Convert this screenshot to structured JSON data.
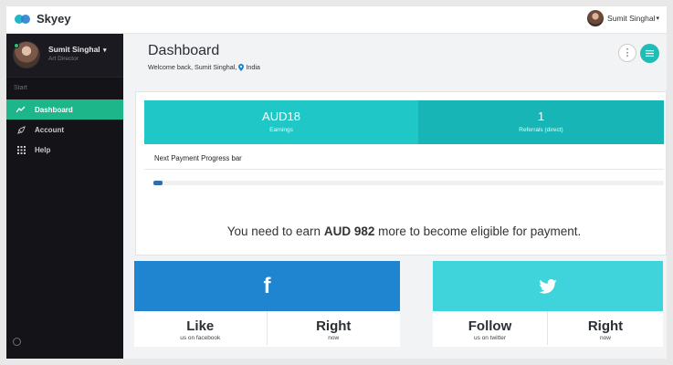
{
  "brand": {
    "name": "Skyey",
    "accent": "#1fbdb5"
  },
  "topbar": {
    "user_name": "Sumit Singhal"
  },
  "sidebar": {
    "profile": {
      "name": "Sumit Singhal",
      "role": "Art Director"
    },
    "section_label": "Start",
    "items": [
      {
        "label": "Dashboard",
        "icon": "trend-icon",
        "active": true
      },
      {
        "label": "Account",
        "icon": "rocket-icon",
        "active": false
      },
      {
        "label": "Help",
        "icon": "grid-icon",
        "active": false
      }
    ]
  },
  "header": {
    "title": "Dashboard",
    "welcome": "Welcome back, Sumit Singhal,",
    "location": "India"
  },
  "stats": {
    "earnings": {
      "value": "AUD18",
      "label": "Earnings"
    },
    "referrals": {
      "value": "1",
      "label": "Referrals (direct)"
    }
  },
  "progress": {
    "label": "Next Payment Progress bar",
    "fraction": 0.018,
    "color": "#2e6fa8"
  },
  "eligibility": {
    "prefix": "You need to earn",
    "amount": "AUD 982",
    "suffix": "more to become eligible for payment."
  },
  "social": {
    "facebook": {
      "color": "#1f85d0",
      "left_big": "Like",
      "left_small": "us on facebook",
      "right_big": "Right",
      "right_small": "now"
    },
    "twitter": {
      "color": "#3fd3db",
      "left_big": "Follow",
      "left_small": "us on twitter",
      "right_big": "Right",
      "right_small": "now"
    }
  }
}
